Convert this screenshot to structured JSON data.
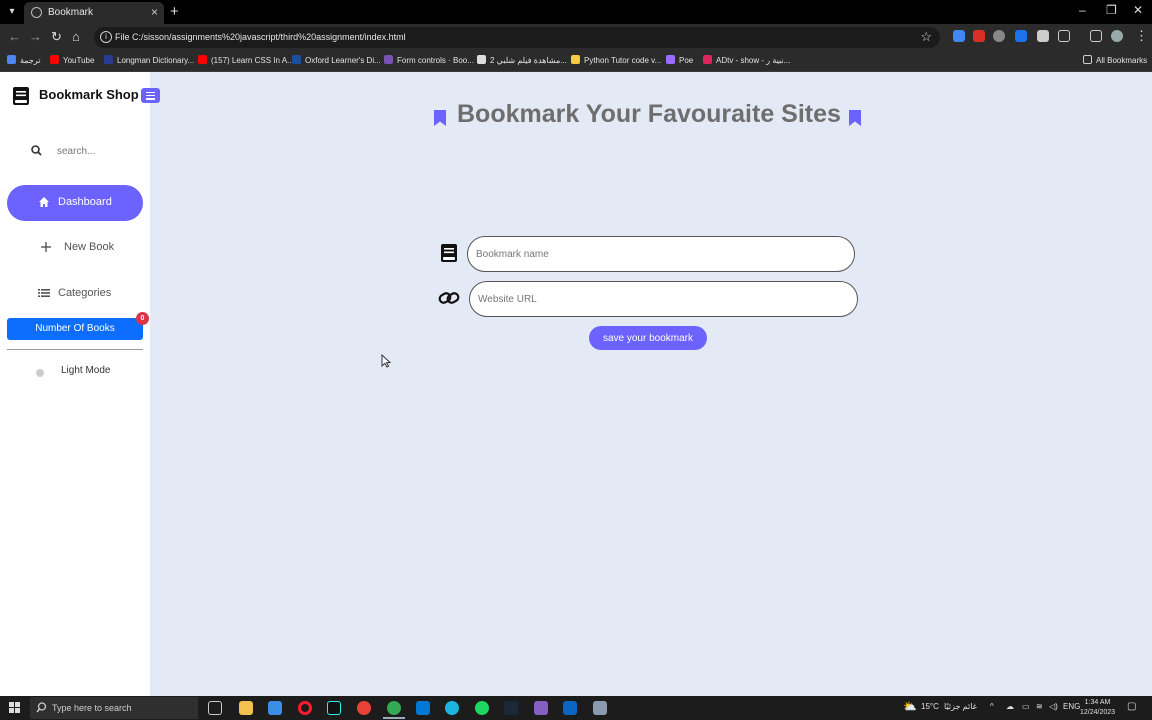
{
  "browser": {
    "tab_title": "Bookmark",
    "address": {
      "scheme_label": "File",
      "url": "C:/sisson/assignments%20javascript/third%20assignment/index.html"
    },
    "bookmarks_bar": [
      {
        "label": "ترجمة",
        "color": "#4f86f7"
      },
      {
        "label": "YouTube",
        "color": "#ff0000"
      },
      {
        "label": "Longman Dictionary...",
        "color": "#2a3b8f"
      },
      {
        "label": "(157) Learn CSS In A...",
        "color": "#ff0000"
      },
      {
        "label": "Oxford Learner's Di...",
        "color": "#1f4e9c"
      },
      {
        "label": "Form controls · Boo...",
        "color": "#7952b3"
      },
      {
        "label": "مشاهدة فيلم شلبي 2...",
        "color": "#dddddd"
      },
      {
        "label": "Python Tutor code v...",
        "color": "#f7c948"
      },
      {
        "label": "Poe",
        "color": "#9b6cff"
      },
      {
        "label": "ADtv - show - نبية ر...",
        "color": "#e0245e"
      }
    ],
    "all_bookmarks_label": "All Bookmarks"
  },
  "sidebar": {
    "brand": "Bookmark Shop",
    "search_placeholder": "search...",
    "nav": [
      {
        "label": "Dashboard",
        "icon": "home-icon",
        "active": true
      },
      {
        "label": "New Book",
        "icon": "plus-icon",
        "active": false
      },
      {
        "label": "Categories",
        "icon": "list-icon",
        "active": false
      }
    ],
    "books_count_label": "Number Of Books",
    "books_count": "0",
    "mode_label": "Light Mode"
  },
  "main": {
    "heading": "Bookmark Your Favouraite Sites",
    "name_placeholder": "Bookmark name",
    "url_placeholder": "Website URL",
    "save_label": "save your bookmark"
  },
  "taskbar": {
    "search_placeholder": "Type here to search",
    "weather": "15°C",
    "weather_text": "غائم جزئيًا",
    "language": "ENG",
    "time": "1:34 AM",
    "date": "12/24/2023"
  },
  "colors": {
    "accent": "#6c63ff",
    "primary_button": "#0d6efd",
    "badge": "#dc3545",
    "page_bg": "#e4e9f6"
  }
}
